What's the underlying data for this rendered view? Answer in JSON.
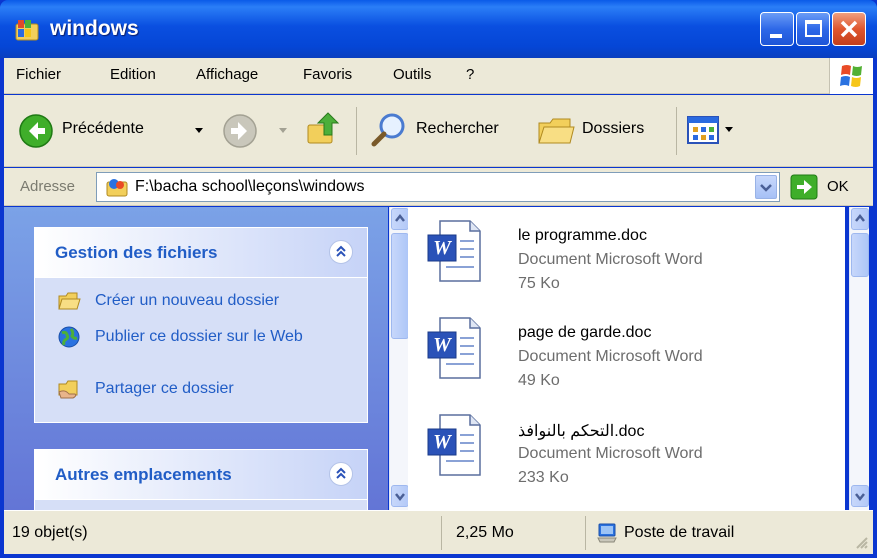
{
  "window": {
    "title": "windows",
    "buttons": [
      "minimize",
      "maximize",
      "close"
    ]
  },
  "menu": {
    "items": [
      "Fichier",
      "Edition",
      "Affichage",
      "Favoris",
      "Outils",
      "?"
    ]
  },
  "toolbar": {
    "back_label": "Précédente",
    "search_label": "Rechercher",
    "folders_label": "Dossiers"
  },
  "address": {
    "label": "Adresse",
    "path": "F:\\bacha school\\leçons\\windows",
    "go_label": "OK"
  },
  "tasks": {
    "file_section_title": "Gestion des fichiers",
    "links": [
      {
        "label": "Créer un nouveau dossier",
        "icon": "new-folder-icon"
      },
      {
        "label": "Publier ce dossier sur le Web",
        "icon": "publish-web-icon"
      },
      {
        "label": "Partager ce dossier",
        "icon": "share-folder-icon"
      }
    ],
    "other_section_title": "Autres emplacements"
  },
  "files": [
    {
      "name": "le programme.doc",
      "type": "Document Microsoft Word",
      "size": "75 Ko"
    },
    {
      "name": "page de garde.doc",
      "type": "Document Microsoft Word",
      "size": "49 Ko"
    },
    {
      "name": "التحكم بالنوافذ.doc",
      "type": "Document Microsoft Word",
      "size": "233 Ko"
    }
  ],
  "status": {
    "count": "19 objet(s)",
    "size": "2,25 Mo",
    "location": "Poste de travail"
  },
  "colors": {
    "title_blue": "#0a4fe0",
    "link_blue": "#215dc6",
    "pane_blue": "#7ba2e7",
    "bar_beige": "#ece9d8"
  }
}
